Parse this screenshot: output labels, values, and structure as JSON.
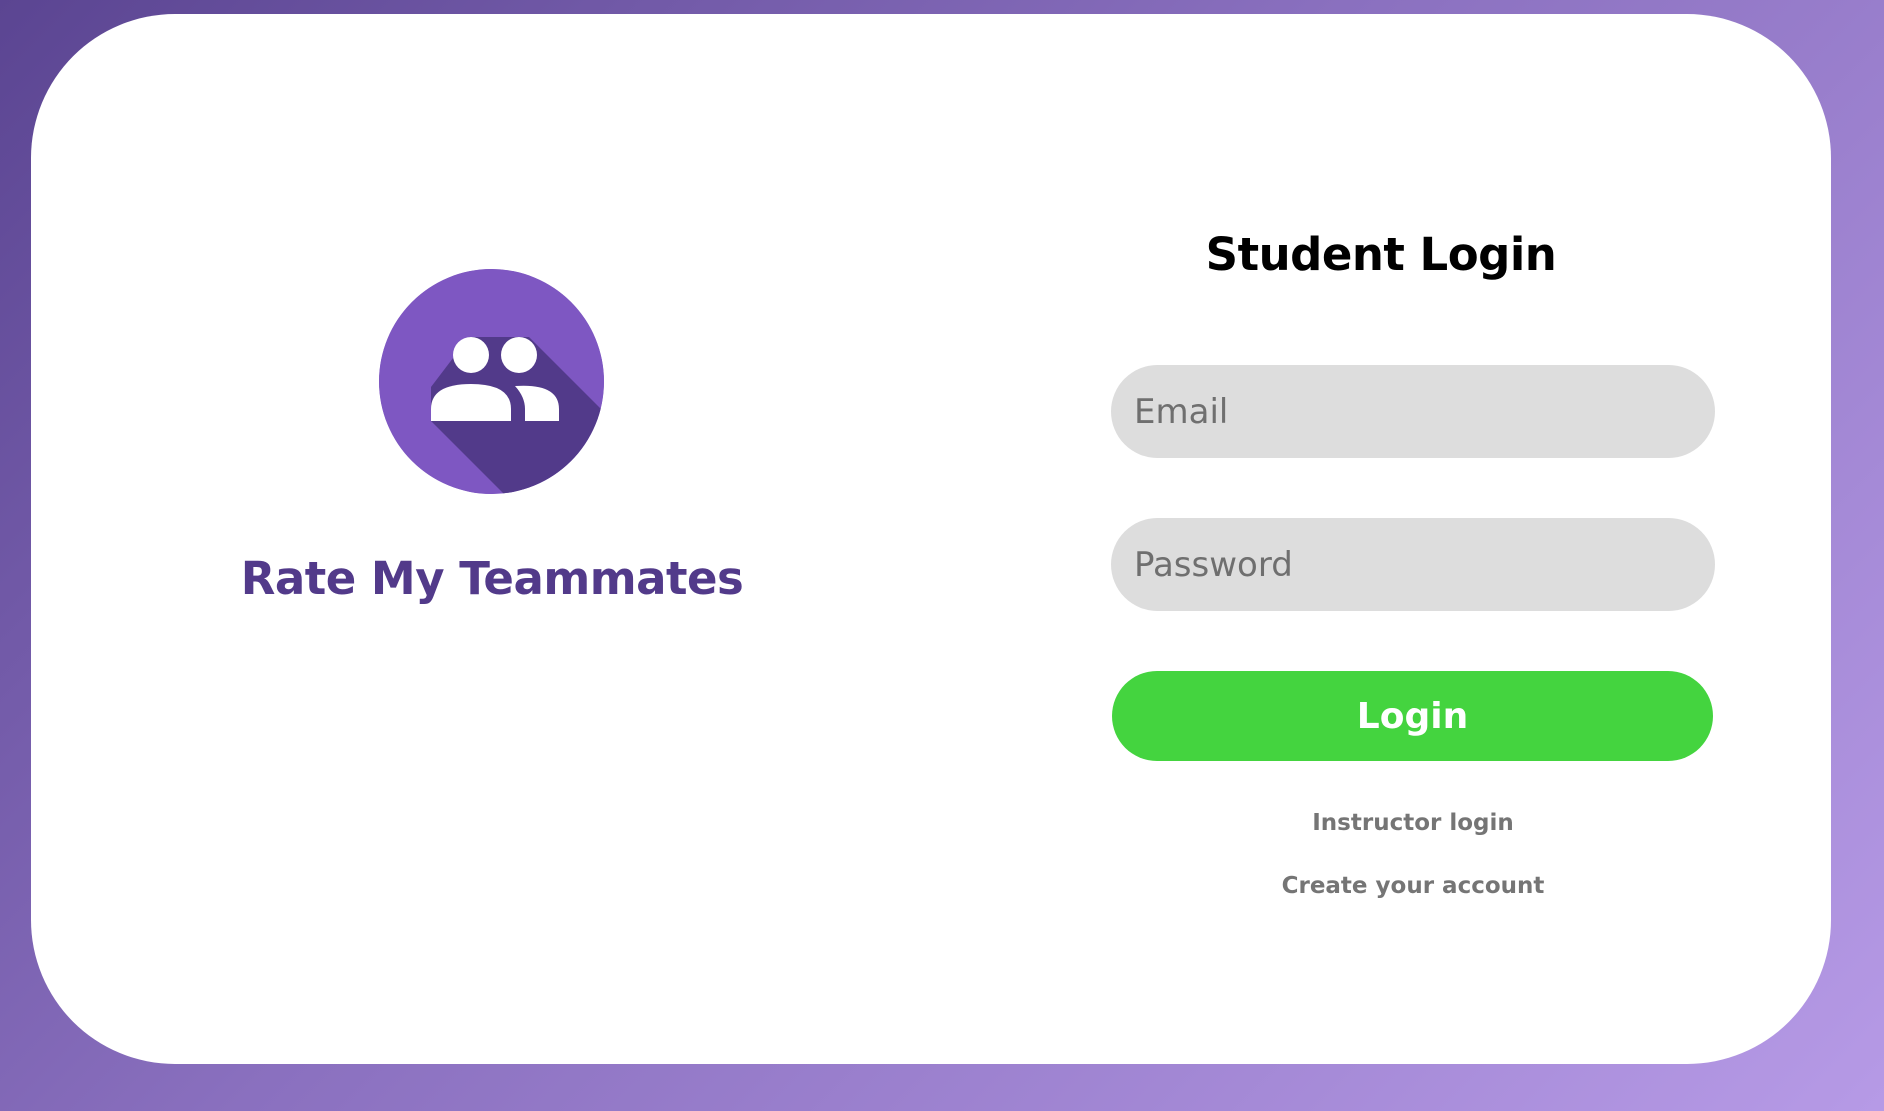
{
  "colors": {
    "background_start": "#5b4592",
    "background_end": "#b69ae6",
    "card": "#ffffff",
    "brand_purple": "#7e57c2",
    "brand_text": "#523a8a",
    "field_bg": "#dddddd",
    "login_button": "#44d43f",
    "link_text": "#757575"
  },
  "brand": {
    "icon": "group-people-icon",
    "title": "Rate My Teammates"
  },
  "login": {
    "title": "Student Login",
    "email_placeholder": "Email",
    "email_value": "",
    "password_placeholder": "Password",
    "password_value": "",
    "button_label": "Login",
    "instructor_link": "Instructor login",
    "create_account_link": "Create your account"
  }
}
